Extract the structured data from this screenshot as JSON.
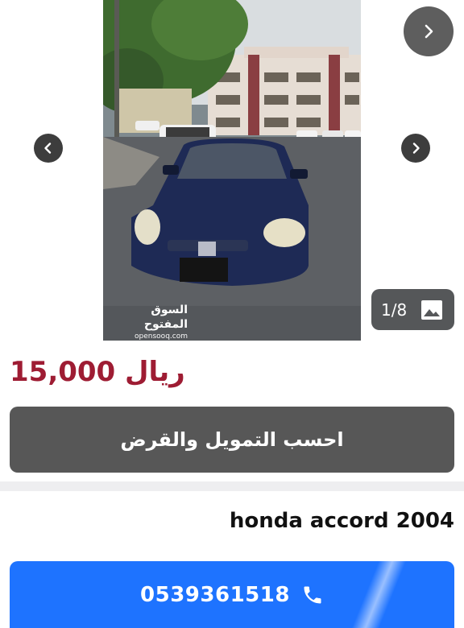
{
  "gallery": {
    "counter_text": "1/8",
    "watermark_ar": "السوق المفتوح",
    "watermark_en": "opensooq.com",
    "photo_subject": "car-photo"
  },
  "listing": {
    "price": "15,000 ريال",
    "finance_button_label": "احسب التمويل والقرض",
    "title": "honda accord 2004",
    "phone": "0539361518"
  },
  "icons": {
    "next_big": "chevron-right-icon",
    "prev": "chevron-left-icon",
    "next": "chevron-right-icon",
    "gallery": "image-icon",
    "phone": "phone-icon"
  },
  "colors": {
    "price": "#9e1c33",
    "call_button": "#1e73ff",
    "finance_button": "#575757"
  }
}
